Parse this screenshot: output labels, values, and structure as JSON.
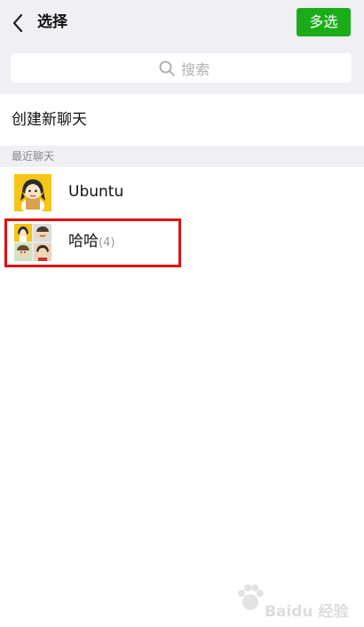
{
  "header": {
    "back_icon": "chevron-left-icon",
    "title": "选择",
    "multi_select_label": "多选",
    "accent_color": "#1aad19"
  },
  "search": {
    "icon": "search-icon",
    "placeholder": "搜索"
  },
  "create_chat": {
    "label": "创建新聊天"
  },
  "recent": {
    "section_label": "最近聊天",
    "chats": [
      {
        "name": "Ubuntu",
        "count": ""
      },
      {
        "name": "哈哈",
        "count": "(4)"
      }
    ]
  },
  "annotation": {
    "highlight_color": "#e01010"
  },
  "watermark": {
    "text": "Baidu 经验"
  }
}
